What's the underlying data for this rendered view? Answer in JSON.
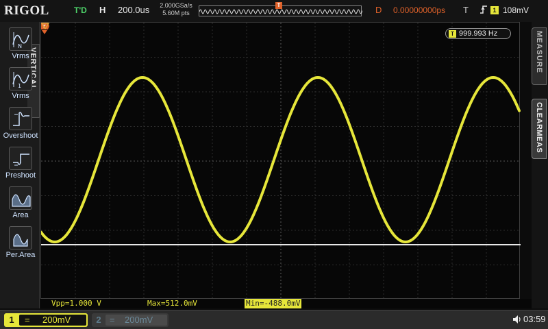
{
  "header": {
    "brand": "RIGOL",
    "run_state": "T'D",
    "horizontal_label": "H",
    "timebase": "200.0us",
    "sample_rate": "2.000GSa/s",
    "memory_depth": "5.60M pts",
    "delay_label": "D",
    "delay_value": "0.00000000ps",
    "trigger_label": "T",
    "trigger_edge_icon": "rising-edge-icon",
    "trigger_source": "1",
    "trigger_level": "108mV"
  },
  "left_menu": {
    "tab_label": "VERTICAL",
    "items": [
      {
        "label": "Vrms",
        "icon": "vrms-n-cycles-icon"
      },
      {
        "label": "Vrms",
        "icon": "vrms-1-cycle-icon"
      },
      {
        "label": "Overshoot",
        "icon": "overshoot-icon"
      },
      {
        "label": "Preshoot",
        "icon": "preshoot-icon"
      },
      {
        "label": "Area",
        "icon": "area-icon"
      },
      {
        "label": "Per.Area",
        "icon": "period-area-icon"
      }
    ]
  },
  "right_menu": {
    "measure_tab": "MEASURE",
    "clear_tab": "CLEARMEAS"
  },
  "screen": {
    "frequency_badge": "T",
    "frequency": "999.993 Hz",
    "trace_color": "#e6e63a",
    "trigger_marker_color": "#e0622a"
  },
  "measurements": [
    {
      "text": "Vpp=1.000 V",
      "highlight": false
    },
    {
      "text": "Max=512.0mV",
      "highlight": false
    },
    {
      "text": "Min=-488.0mV",
      "highlight": true
    }
  ],
  "channels": {
    "ch1": {
      "number": "1",
      "coupling": "=",
      "scale": "200mV",
      "active": true
    },
    "ch2": {
      "number": "2",
      "coupling": "=",
      "scale": "200mV",
      "active": false
    }
  },
  "status": {
    "speaker_icon": "speaker-icon",
    "clock": "03:59"
  }
}
